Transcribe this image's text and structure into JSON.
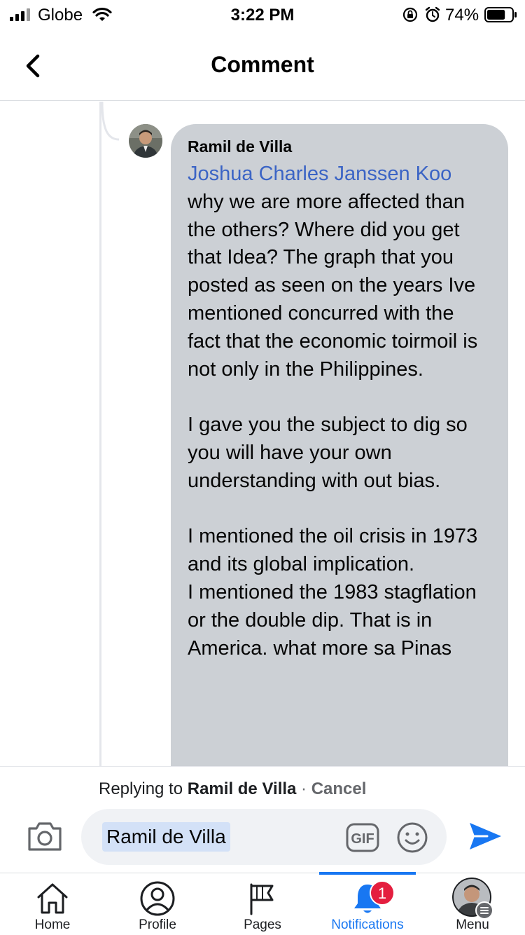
{
  "status_bar": {
    "carrier": "Globe",
    "time": "3:22 PM",
    "battery_percent": "74%",
    "battery_level": 0.74
  },
  "header": {
    "title": "Comment",
    "back_icon": "chevron-left-icon"
  },
  "comment": {
    "author": "Ramil de Villa",
    "mention": "Joshua Charles Janssen Koo",
    "paragraphs": [
      "why we are more affected than the others? Where did you get that Idea? The graph that you posted as seen on the years Ive mentioned concurred with the fact that the economic toirmoil is not only in the Philippines.",
      "I gave you the subject to dig so you will have your own understanding with out bias.",
      "I mentioned the oil crisis in 1973 and its global implication.",
      "I mentioned the 1983 stagflation or the double dip. That is in America. what more sa Pinas"
    ],
    "bubble_color": "#ccd0d5",
    "mention_color": "#3b64c5"
  },
  "reply_bar": {
    "replying_prefix": "Replying to",
    "replying_name": "Ramil de Villa",
    "separator": "·",
    "cancel_label": "Cancel",
    "input_value": "Ramil de Villa",
    "gif_label": "GIF",
    "icons": [
      "camera-icon",
      "gif-icon",
      "emoji-icon",
      "send-icon"
    ]
  },
  "tabbar": {
    "tabs": [
      {
        "label": "Home",
        "icon": "home-icon"
      },
      {
        "label": "Profile",
        "icon": "profile-icon"
      },
      {
        "label": "Pages",
        "icon": "flag-icon"
      },
      {
        "label": "Notifications",
        "icon": "bell-icon",
        "active": true,
        "badge": "1"
      },
      {
        "label": "Menu",
        "icon": "menu-avatar-icon"
      }
    ],
    "active_color": "#1877f2",
    "badge_color": "#e41e3f"
  }
}
